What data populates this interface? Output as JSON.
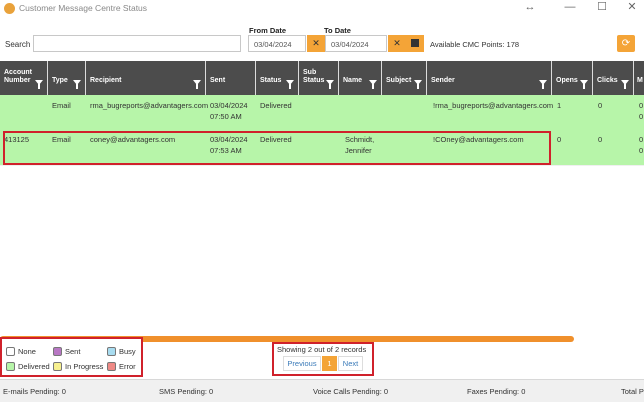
{
  "window": {
    "title": "Customer Message Centre Status",
    "controls": [
      "↔",
      "—",
      "☐",
      "✕"
    ]
  },
  "toolbar": {
    "search_label": "Search",
    "search_value": "",
    "from_label": "From Date",
    "from_value": "03/04/2024",
    "to_label": "To Date",
    "to_value": "03/04/2024",
    "clear_glyph": "✕",
    "cmc_points": "Available CMC Points: 178",
    "refresh_glyph": "⟳"
  },
  "columns": [
    {
      "key": "account",
      "label": "Account\nNumber"
    },
    {
      "key": "type",
      "label": "Type"
    },
    {
      "key": "recipient",
      "label": "Recipient"
    },
    {
      "key": "sent",
      "label": "Sent"
    },
    {
      "key": "status",
      "label": "Status"
    },
    {
      "key": "substatus",
      "label": "Sub\nStatus"
    },
    {
      "key": "name",
      "label": "Name"
    },
    {
      "key": "subject",
      "label": "Subject"
    },
    {
      "key": "sender",
      "label": "Sender"
    },
    {
      "key": "opens",
      "label": "Opens"
    },
    {
      "key": "clicks",
      "label": "Clicks"
    },
    {
      "key": "more",
      "label": "M"
    }
  ],
  "rows": [
    {
      "account": "",
      "type": "Email",
      "recipient": "rma_bugreports@advantagers.com",
      "sent": "03/04/2024\n07:50 AM",
      "status": "Delivered",
      "substatus": "",
      "name": "",
      "subject": "",
      "sender": "!rma_bugreports@advantagers.com",
      "opens": "1",
      "clicks": "0",
      "more": "0\n0"
    },
    {
      "account": "413125",
      "type": "Email",
      "recipient": "coney@advantagers.com",
      "sent": "03/04/2024\n07:53 AM",
      "status": "Delivered",
      "substatus": "",
      "name": "Schmidt,\nJennifer",
      "subject": "",
      "sender": "!COney@advantagers.com",
      "opens": "0",
      "clicks": "0",
      "more": "0\n0"
    }
  ],
  "legend": [
    {
      "label": "None",
      "color": "#ffffff"
    },
    {
      "label": "Sent",
      "color": "#b877c4"
    },
    {
      "label": "Busy",
      "color": "#a8dcf0"
    },
    {
      "label": "Delivered",
      "color": "#b7f5a9"
    },
    {
      "label": "In Progress",
      "color": "#f7f08f"
    },
    {
      "label": "Error",
      "color": "#ef8a86"
    }
  ],
  "pagination": {
    "showing": "Showing  2  out of 2 records",
    "previous": "Previous",
    "current": "1",
    "next": "Next"
  },
  "status_bar": {
    "emails": "E-mails Pending: 0",
    "sms": "SMS Pending: 0",
    "voice": "Voice Calls Pending: 0",
    "faxes": "Faxes Pending: 0",
    "total": "Total P"
  },
  "colors": {
    "accent": "#f4a437",
    "header_bg": "#4c4c4c",
    "row_delivered": "#b7f5a9",
    "highlight": "#d0212b"
  }
}
